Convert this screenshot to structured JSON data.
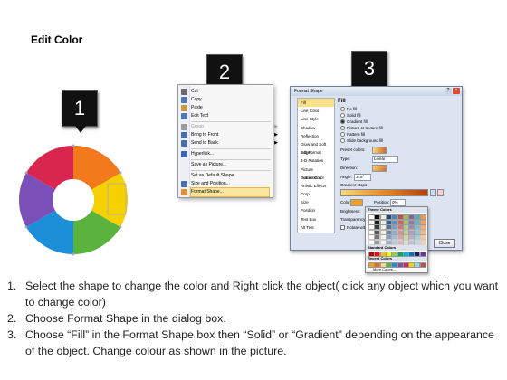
{
  "title": "Edit Color",
  "badges": [
    "1",
    "2",
    "3"
  ],
  "context_menu": {
    "items": [
      {
        "label": "Cut",
        "icon": "scissors-icon",
        "color": "#6a6a6a"
      },
      {
        "label": "Copy",
        "icon": "copy-icon",
        "color": "#5078b8"
      },
      {
        "label": "Paste",
        "icon": "clipboard-icon",
        "color": "#c89a40"
      },
      {
        "label": "Edit Text",
        "icon": "text-edit-icon",
        "color": "#5078b8"
      },
      {
        "label": "Group",
        "icon": "group-icon",
        "color": "#999999"
      },
      {
        "label": "Bring to Front",
        "icon": "bring-front-icon",
        "color": "#4a6fa8"
      },
      {
        "label": "Send to Back",
        "icon": "send-back-icon",
        "color": "#4a6fa8"
      },
      {
        "label": "Hyperlink...",
        "icon": "link-icon",
        "color": "#3c64b4"
      },
      {
        "label": "Save as Picture...",
        "icon": "",
        "color": ""
      },
      {
        "label": "Set as Default Shape",
        "icon": "",
        "color": ""
      },
      {
        "label": "Size and Position...",
        "icon": "size-icon",
        "color": "#4a6fa8"
      },
      {
        "label": "Format Shape...",
        "icon": "format-shape-icon",
        "color": "#e09030"
      }
    ]
  },
  "format_dialog": {
    "title": "Format Shape",
    "left_items": [
      "Fill",
      "Line Color",
      "Line Style",
      "Shadow",
      "Reflection",
      "Glow and Soft Edges",
      "3-D Format",
      "3-D Rotation",
      "Picture Corrections",
      "Picture Color",
      "Artistic Effects",
      "Crop",
      "Size",
      "Position",
      "Text Box",
      "Alt Text"
    ],
    "fill_heading": "Fill",
    "options": [
      "No fill",
      "Solid fill",
      "Gradient fill",
      "Picture or texture fill",
      "Pattern fill",
      "Slide background fill"
    ],
    "preset_label": "Preset colors:",
    "type_label": "Type:",
    "type_value": "Linear",
    "direction_label": "Direction:",
    "angle_label": "Angle:",
    "angle_value": "315°",
    "stops_label": "Gradient stops",
    "color_label": "Color",
    "position_label": "Position:",
    "position_value": "0%",
    "brightness_label": "Brightness:",
    "transparency_label": "Transparency:",
    "rotate_label": "Rotate with shape",
    "close_label": "Close"
  },
  "color_picker": {
    "theme_label": "Theme Colors",
    "standard_label": "Standard Colors",
    "recent_label": "Recent Colors",
    "more_label": "More Colors..."
  },
  "steps": [
    "Select the shape to change the color and Right click the object( click any object which you want to change color)",
    "Choose Format Shape in the dialog box.",
    "Choose “Fill” in the Format Shape box then “Solid” or “Gradient” depending on the appearance of the object. Change colour as shown in the picture."
  ]
}
